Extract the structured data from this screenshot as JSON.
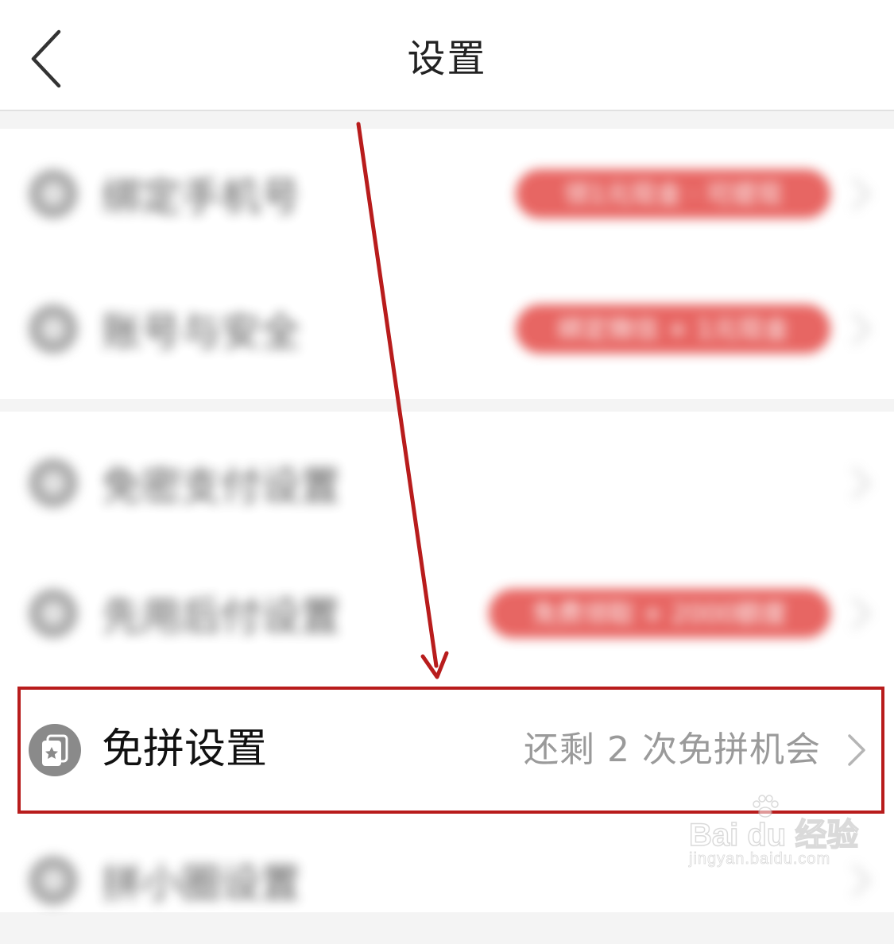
{
  "header": {
    "title": "设置",
    "back_icon": "chevron-left-icon"
  },
  "blurred_rows": [
    {
      "label": "绑定手机号",
      "badge": "领1元现金 · 可提现"
    },
    {
      "label": "账号与安全",
      "badge": "绑定微信 + 1元现金"
    },
    {
      "label": "免密支付设置",
      "badge": ""
    },
    {
      "label": "先用后付设置",
      "badge": "免费领取 + 2000额度"
    },
    {
      "label": "拼小圈设置",
      "badge": ""
    }
  ],
  "highlight_row": {
    "label": "免拼设置",
    "value": "还剩 2 次免拼机会",
    "icon": "card-star-icon",
    "chevron_icon": "chevron-right-icon"
  },
  "watermark": {
    "logo_text": "Bai du 经验",
    "url": "jingyan.baidu.com"
  },
  "colors": {
    "annotation": "#b81c1c",
    "badge": "#e0332f",
    "value_text": "#9a9a9a"
  }
}
